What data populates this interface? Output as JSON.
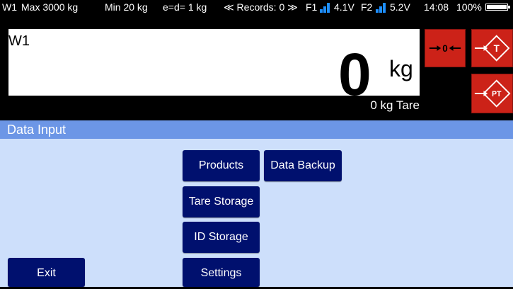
{
  "status": {
    "scale_id": "W1",
    "max": "Max 3000 kg",
    "min": "Min 20 kg",
    "division": "e=d= 1 kg",
    "records": "≪ Records: 0 ≫",
    "f1_label": "F1",
    "f1_voltage": "4.1V",
    "f2_label": "F2",
    "f2_voltage": "5.2V",
    "time": "14:08",
    "battery": "100%"
  },
  "weight": {
    "scale_name": "W1",
    "value": "0",
    "unit": "kg",
    "tare": "0 kg Tare"
  },
  "scale_buttons": {
    "zero_icon": "zero-arrow-icon",
    "tare_icon": "tare-arrow-icon",
    "preset_tare_icon": "preset-tare-arrow-icon"
  },
  "section": {
    "title": "Data Input"
  },
  "menu": {
    "products": "Products",
    "data_backup": "Data Backup",
    "tare_storage": "Tare Storage",
    "id_storage": "ID Storage",
    "settings": "Settings",
    "exit": "Exit"
  },
  "colors": {
    "header": "#6c96e6",
    "content_bg": "#cddffb",
    "button": "#00106e",
    "scale_button": "#cc2218",
    "signal": "#1e8fff"
  }
}
